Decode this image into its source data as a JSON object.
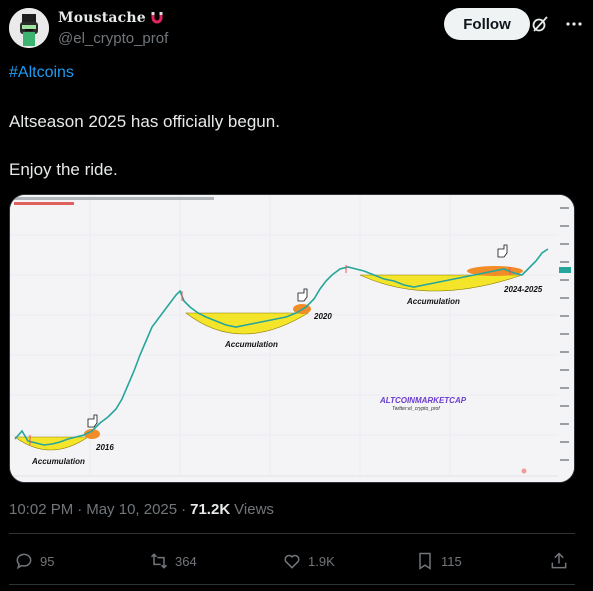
{
  "author": {
    "display_name": "Moustache",
    "handle": "@el_crypto_prof",
    "badge_icon": "magnet-icon"
  },
  "header": {
    "follow_label": "Follow",
    "grok_icon": "grok-icon",
    "more_icon": "more-icon"
  },
  "post": {
    "hashtag": "#Altcoins",
    "line1": "Altseason 2025 has officially begun.",
    "line2": "Enjoy the ride."
  },
  "chart_image": {
    "labels": {
      "accumulation": "Accumulation",
      "year_2016": "2016",
      "year_2020": "2020",
      "year_2024_2025": "2024-2025",
      "watermark": "ALTCOINMARKETCAP",
      "watermark_sub": "Twitter:el_crypto_prof"
    },
    "colors": {
      "accumulation_fill": "#f5e52a",
      "highlight": "#f28c28",
      "watermark": "#6a3ccf",
      "candle_up": "#26a69a",
      "candle_down": "#ef5350"
    }
  },
  "meta": {
    "time": "10:02 PM",
    "sep1": "·",
    "date": "May 10, 2025",
    "sep2": "·",
    "views_count": "71.2K",
    "views_label": "Views"
  },
  "actions": {
    "replies": "95",
    "reposts": "364",
    "likes": "1.9K",
    "bookmarks": "115"
  }
}
